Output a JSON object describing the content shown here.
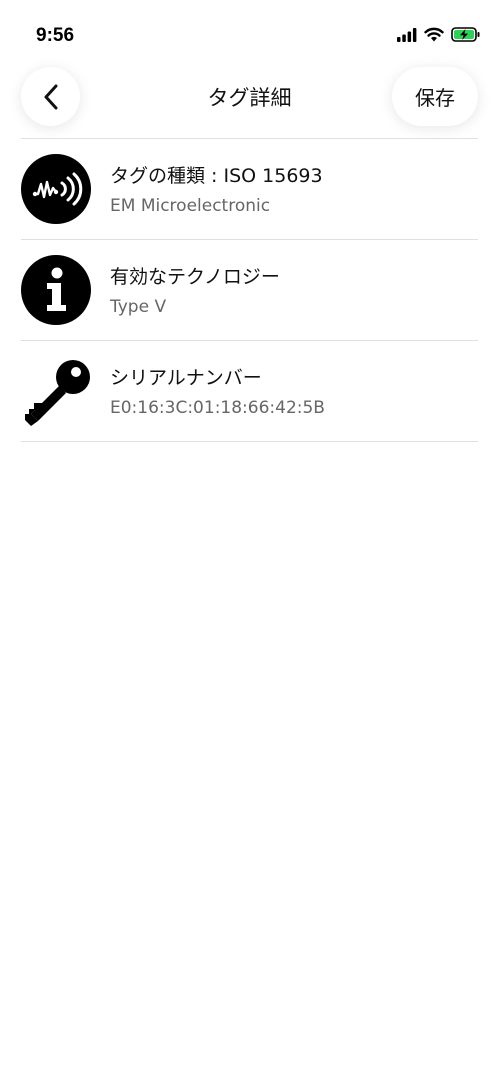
{
  "status_bar": {
    "time": "9:56",
    "icons": [
      "cellular-signal-icon",
      "wifi-icon",
      "battery-charging-icon"
    ]
  },
  "nav": {
    "back_icon": "chevron-left-icon",
    "title": "タグ詳細",
    "save_label": "保存"
  },
  "items": [
    {
      "icon": "nfc-signal-icon",
      "title": "タグの種類 : ISO 15693",
      "subtitle": "EM Microelectronic"
    },
    {
      "icon": "info-icon",
      "title": "有効なテクノロジー",
      "subtitle": "Type V"
    },
    {
      "icon": "key-icon",
      "title": "シリアルナンバー",
      "subtitle": "E0:16:3C:01:18:66:42:5B"
    }
  ],
  "colors": {
    "battery_charging": "#30d158",
    "divider": "#e0e0e0",
    "subtitle_text": "#666666"
  }
}
